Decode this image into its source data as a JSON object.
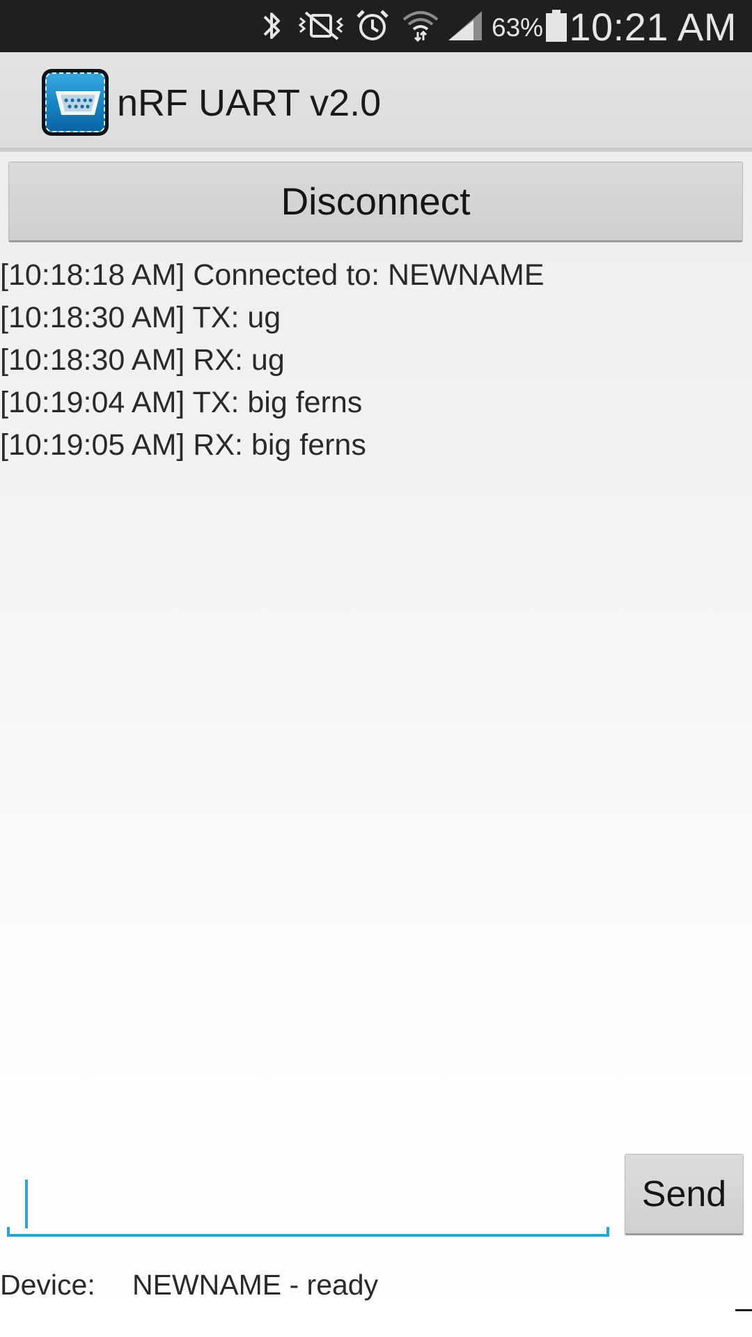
{
  "status_bar": {
    "battery_percent": "63%",
    "time": "10:21 AM",
    "icons": [
      "bluetooth-icon",
      "mute-icon",
      "alarm-icon",
      "wifi-icon",
      "signal-icon",
      "battery-icon"
    ]
  },
  "action_bar": {
    "title": "nRF UART v2.0",
    "icon": "serial-port-icon"
  },
  "connection": {
    "button_label": "Disconnect"
  },
  "log": {
    "messages": [
      "[10:18:18 AM] Connected to: NEWNAME",
      "[10:18:30 AM] TX: ug",
      "[10:18:30 AM] RX: ug",
      "[10:19:04 AM] TX: big ferns",
      "[10:19:05 AM] RX: big ferns"
    ]
  },
  "composer": {
    "input_value": "",
    "send_label": "Send"
  },
  "device": {
    "label": "Device:",
    "status": "NEWNAME - ready"
  },
  "colors": {
    "accent": "#2aa4d6",
    "status_bar_bg": "#1f1f1f",
    "action_bar_bg": "#e0e0e0"
  }
}
